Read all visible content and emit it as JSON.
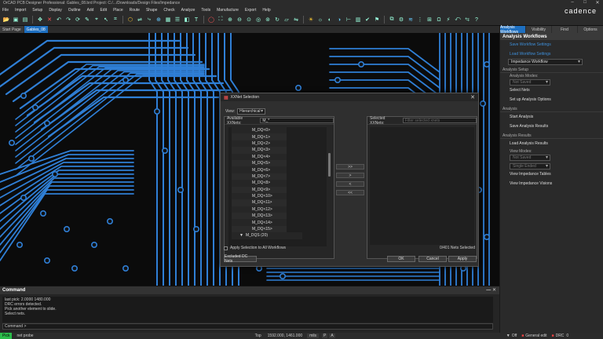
{
  "titlebar": {
    "title": "OrCAD PCB Designer Professional: Gables_08.brd  Project: C:/.../Downloads/Design Files/Impedance"
  },
  "menu": [
    "File",
    "Import",
    "Setup",
    "Display",
    "Outline",
    "Add",
    "Edit",
    "Place",
    "Route",
    "Shape",
    "Check",
    "Analyze",
    "Tools",
    "Manufacture",
    "Export",
    "Help"
  ],
  "brand": "cadence",
  "doctabs": [
    {
      "label": "Start Page",
      "active": false
    },
    {
      "label": "Gables_08",
      "active": true
    }
  ],
  "rpanel": {
    "tabs": [
      {
        "label": "Analysis Workflows",
        "active": true
      },
      {
        "label": "Visibility",
        "active": false
      },
      {
        "label": "Find",
        "active": false
      },
      {
        "label": "Options",
        "active": false
      }
    ],
    "header": "Analysis Workflows",
    "save_settings": "Save Workflow Settings",
    "load_settings": "Load Workflow Settings",
    "workflow_select": "Impedance Workflow",
    "setup_section": "Analysis Setup",
    "modes_label": "Analysis Modes:",
    "modes_value": "Not Saved",
    "select_nets": "Select Nets",
    "setup_options": "Set up Analysis Options",
    "analysis_section": "Analysis",
    "start_analysis": "Start Analysis",
    "save_results": "Save Analysis Results",
    "results_section": "Analysis Results",
    "load_results": "Load Analysis Results",
    "view_modes_label": "View Modes:",
    "view_modes_value": "Not Saved",
    "single_ended": "Single Ended",
    "view_tables": "View Impedance Tables",
    "view_visions": "View Impedance Visions"
  },
  "dialog": {
    "title": "XXNet Selection",
    "view_label": "View:",
    "view_value": "Hierarchical",
    "available_label": "Available XXNets:",
    "available_filter": "M_*",
    "selected_label": "Selected XXNets:",
    "selected_filter_placeholder": "Filter selected xnets",
    "nets": [
      "M_DQ<0>",
      "M_DQ<1>",
      "M_DQ<2>",
      "M_DQ<3>",
      "M_DQ<4>",
      "M_DQ<5>",
      "M_DQ<6>",
      "M_DQ<7>",
      "M_DQ<8>",
      "M_DQ<9>",
      "M_DQ<10>",
      "M_DQ<11>",
      "M_DQ<12>",
      "M_DQ<13>",
      "M_DQ<14>",
      "M_DQ<15>"
    ],
    "group": "M_DQS (20)",
    "buttons": [
      ">>",
      ">",
      "<",
      "<<"
    ],
    "apply_all_label": "Apply Selection to All Workflows",
    "count_text": "0/401 Nets Selected",
    "excluded_btn": "Excluded DC Nets",
    "ok_btn": "OK",
    "cancel_btn": "Cancel",
    "apply_btn": "Apply"
  },
  "command": {
    "header": "Command",
    "log": [
      "last pick: 2.0000 1480.000",
      "DRC errors detected.",
      "Pick another element to slide.",
      "Select nets."
    ],
    "prompt": "Command >"
  },
  "status": {
    "mode": "Pick",
    "command": "net probe",
    "layer": "Top",
    "coords": "1592.000, 1461.000",
    "units": "mils",
    "p_btn": "P",
    "a_btn": "A",
    "off": "Off",
    "general_edit": "General edit",
    "drc": "DRC",
    "drc_count": "0"
  }
}
